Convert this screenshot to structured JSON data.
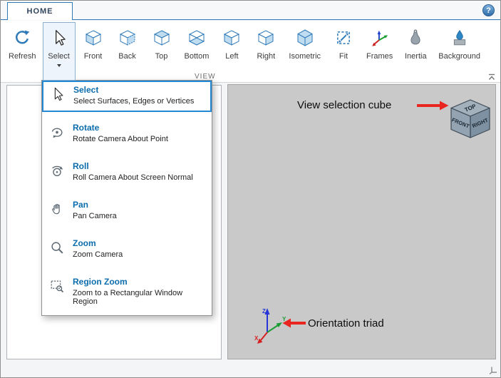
{
  "window": {
    "tab": "HOME",
    "help": "?"
  },
  "ribbon": {
    "section_label": "VIEW",
    "buttons": [
      {
        "label": "Refresh",
        "icon": "refresh-icon"
      },
      {
        "label": "Select",
        "icon": "cursor-icon",
        "open": true
      },
      {
        "label": "Front",
        "icon": "cube-front-icon"
      },
      {
        "label": "Back",
        "icon": "cube-back-icon"
      },
      {
        "label": "Top",
        "icon": "cube-top-icon"
      },
      {
        "label": "Bottom",
        "icon": "cube-bottom-icon"
      },
      {
        "label": "Left",
        "icon": "cube-left-icon"
      },
      {
        "label": "Right",
        "icon": "cube-right-icon"
      },
      {
        "label": "Isometric",
        "icon": "cube-isometric-icon"
      },
      {
        "label": "Fit",
        "icon": "fit-icon"
      },
      {
        "label": "Frames",
        "icon": "frames-icon"
      },
      {
        "label": "Inertia",
        "icon": "inertia-icon"
      },
      {
        "label": "Background",
        "icon": "background-icon"
      }
    ]
  },
  "menu": {
    "items": [
      {
        "title": "Select",
        "subtitle": "Select Surfaces, Edges or Vertices",
        "icon": "cursor-icon",
        "selected": true
      },
      {
        "title": "Rotate",
        "subtitle": "Rotate Camera About Point",
        "icon": "rotate-icon"
      },
      {
        "title": "Roll",
        "subtitle": "Roll Camera About Screen Normal",
        "icon": "roll-icon"
      },
      {
        "title": "Pan",
        "subtitle": "Pan Camera",
        "icon": "pan-icon"
      },
      {
        "title": "Zoom",
        "subtitle": "Zoom Camera",
        "icon": "zoom-icon"
      },
      {
        "title": "Region Zoom",
        "subtitle": "Zoom to a Rectangular Window Region",
        "icon": "region-zoom-icon"
      }
    ]
  },
  "canvas": {
    "annotations": {
      "view_cube_label": "View selection cube",
      "triad_label": "Orientation triad"
    },
    "view_cube": {
      "top": "TOP",
      "front": "FRONT",
      "right": "RIGHT"
    },
    "triad": {
      "z": "Z",
      "y": "Y",
      "x": "X"
    }
  },
  "colors": {
    "accent": "#2f7ab8",
    "accent_light": "#bfdcf0",
    "menu_blue": "#0b6dad",
    "tab_blue": "#3178b6",
    "arrow_red": "#e8251f",
    "canvas_gray": "#c9c9c9"
  }
}
